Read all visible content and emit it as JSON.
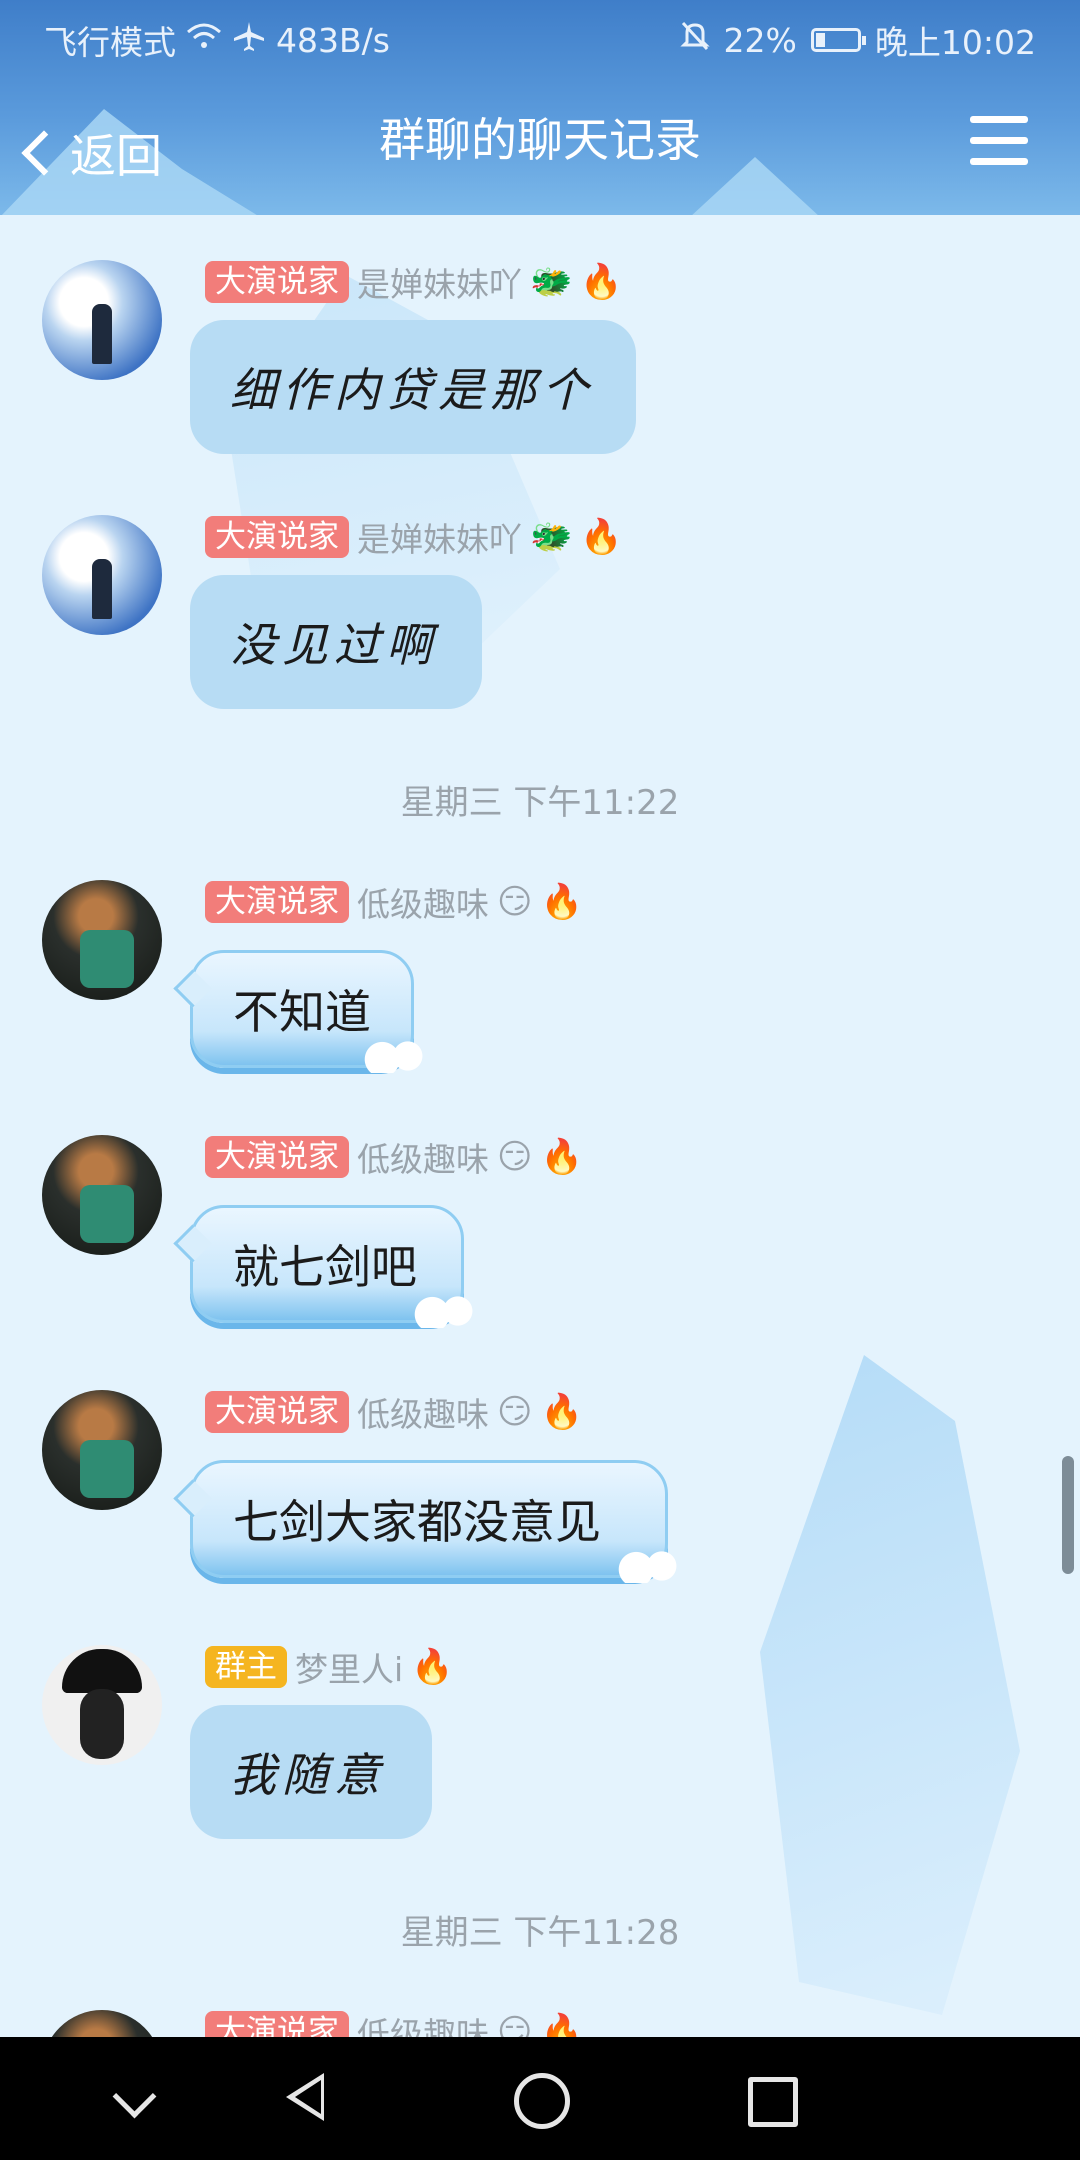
{
  "status_bar": {
    "airplane_mode": "飞行模式",
    "wifi_icon": "wifi-icon",
    "airplane_icon": "airplane-icon",
    "speed": "483B/s",
    "mute_icon": "bell-off-icon",
    "battery_percent": "22%",
    "battery_level": 0.22,
    "time": "晚上10:02"
  },
  "header": {
    "back_label": "返回",
    "title": "群聊的聊天记录",
    "menu_icon": "hamburger-menu-icon"
  },
  "messages": [
    {
      "badge": "大演说家",
      "name": "是婵妹妹吖",
      "emoji1": "🐲",
      "emoji2": "🔥",
      "text": "细作内贷是那个"
    },
    {
      "badge": "大演说家",
      "name": "是婵妹妹吖",
      "emoji1": "🐲",
      "emoji2": "🔥",
      "text": "没见过啊"
    },
    {
      "badge": "大演说家",
      "name": "低级趣味",
      "emoji1": "😏",
      "emoji2": "🔥",
      "text": "不知道"
    },
    {
      "badge": "大演说家",
      "name": "低级趣味",
      "emoji1": "😏",
      "emoji2": "🔥",
      "text": "就七剑吧"
    },
    {
      "badge": "大演说家",
      "name": "低级趣味",
      "emoji1": "😏",
      "emoji2": "🔥",
      "text": "七剑大家都没意见"
    },
    {
      "badge": "群主",
      "name": "梦里人i",
      "emoji2": "🔥",
      "text": "我随意"
    },
    {
      "badge": "大演说家",
      "name": "低级趣味",
      "emoji1": "😏",
      "emoji2": "🔥"
    }
  ],
  "timestamps": [
    "星期三 下午11:22",
    "星期三 下午11:28"
  ],
  "nav_bar": {
    "collapse_icon": "chevron-down-icon",
    "back_icon": "triangle-back-icon",
    "home_icon": "circle-home-icon",
    "recents_icon": "square-recents-icon"
  },
  "colors": {
    "header_blue": "#4f8fd6",
    "chat_bg": "#e4f3fd",
    "badge_red": "#f27d7a",
    "badge_gold": "#f5b520"
  }
}
